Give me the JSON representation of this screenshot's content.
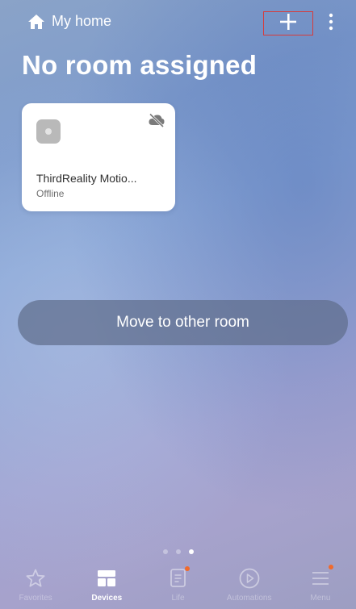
{
  "header": {
    "home_label": "My home",
    "home_icon": "house-icon",
    "add_icon": "plus-icon",
    "more_icon": "more-vertical-icon",
    "add_highlight_color": "#d63b3b"
  },
  "page": {
    "title": "No room assigned"
  },
  "device": {
    "name": "ThirdReality Motio...",
    "status": "Offline",
    "icon": "sensor-icon",
    "status_icon": "cloud-off-icon"
  },
  "actions": {
    "move_label": "Move to other room"
  },
  "pagination": {
    "total": 3,
    "current": 3
  },
  "nav": {
    "items": [
      {
        "label": "Favorites",
        "icon": "star-icon",
        "active": false,
        "badge": false
      },
      {
        "label": "Devices",
        "icon": "devices-grid-icon",
        "active": true,
        "badge": false
      },
      {
        "label": "Life",
        "icon": "life-document-icon",
        "active": false,
        "badge": true
      },
      {
        "label": "Automations",
        "icon": "play-circle-icon",
        "active": false,
        "badge": false
      },
      {
        "label": "Menu",
        "icon": "menu-icon",
        "active": false,
        "badge": true
      }
    ],
    "badge_color": "#f06a2c"
  }
}
